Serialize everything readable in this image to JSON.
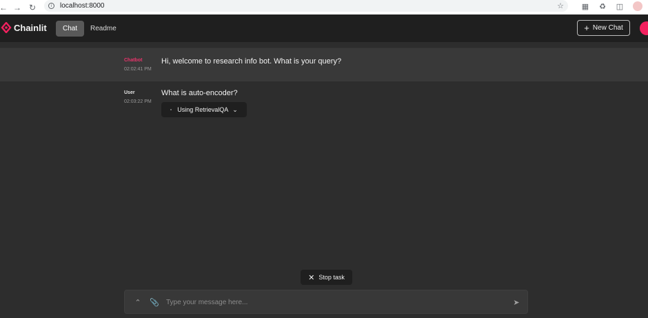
{
  "browser": {
    "url": "localhost:8000",
    "icons": [
      "back-icon",
      "forward-icon",
      "reload-icon",
      "info-icon",
      "star-icon",
      "extension-icon",
      "puzzle-icon",
      "sidepanel-icon",
      "profile-icon"
    ]
  },
  "header": {
    "logo_text": "Chainlit",
    "tabs": [
      {
        "label": "Chat",
        "active": true
      },
      {
        "label": "Readme",
        "active": false
      }
    ],
    "new_chat_label": "New Chat",
    "accent_color": "#f2215f"
  },
  "messages": [
    {
      "author": "Chatbot",
      "time": "02:02:41 PM",
      "text": "Hi, welcome to research info bot. What is your query?"
    },
    {
      "author": "User",
      "time": "02:03:22 PM",
      "text": "What is auto-encoder?",
      "step_label": "Using RetrievalQA"
    }
  ],
  "stop_task_label": "Stop task",
  "composer": {
    "placeholder": "Type your message here..."
  }
}
